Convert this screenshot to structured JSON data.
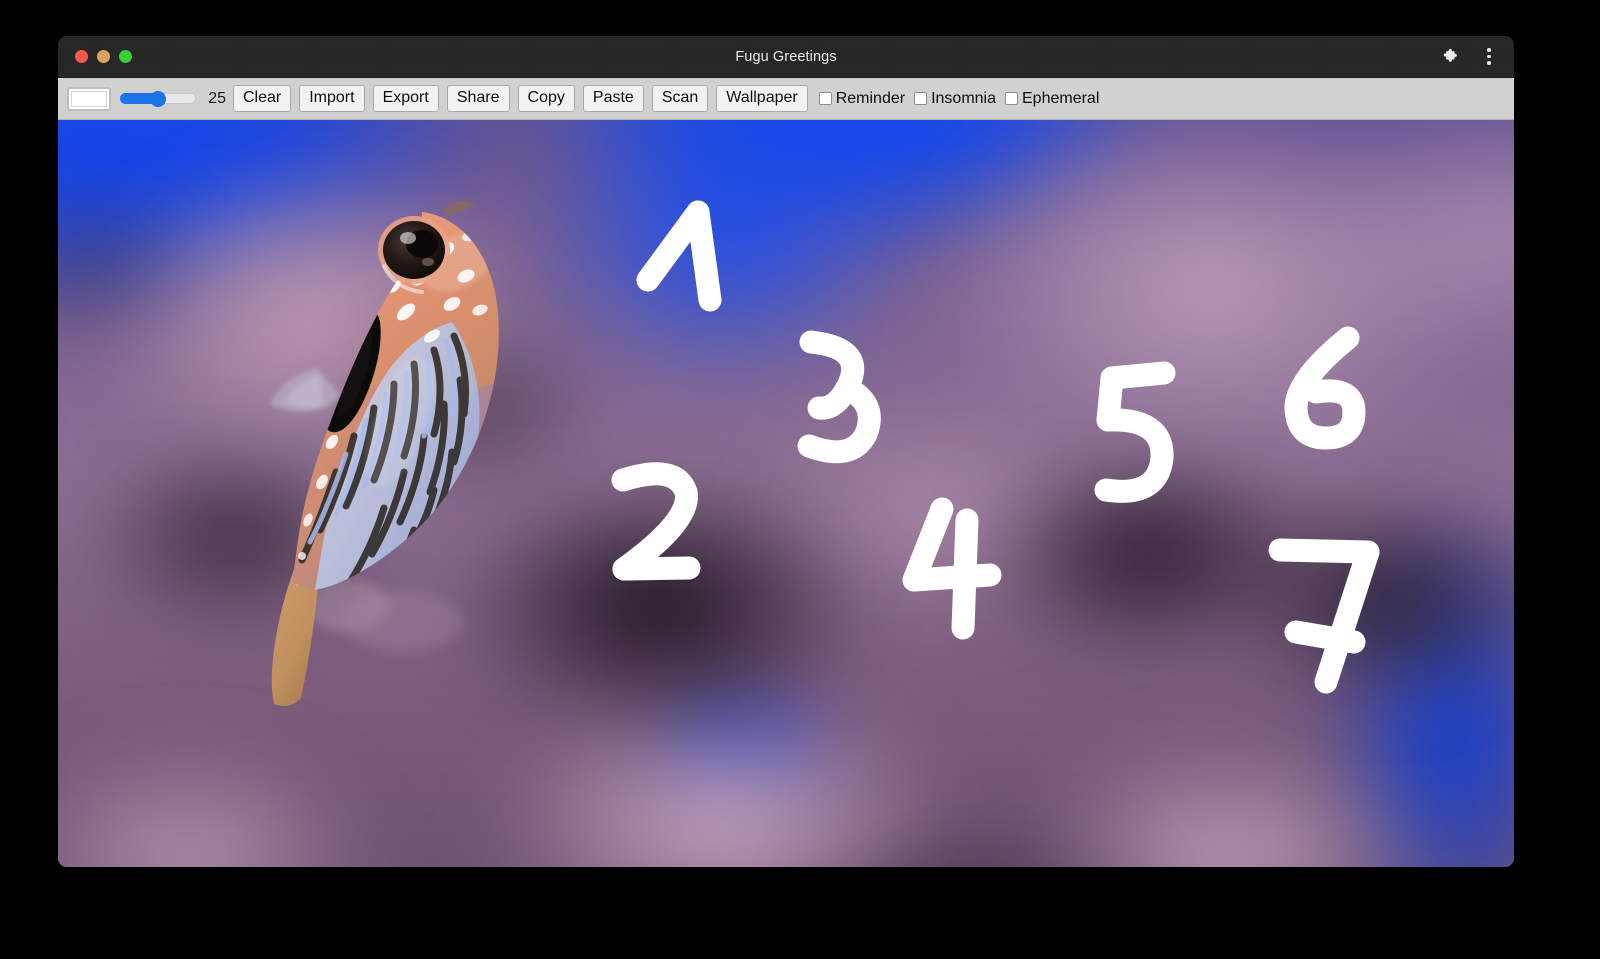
{
  "window": {
    "title": "Fugu Greetings",
    "traffic_lights": [
      {
        "name": "close",
        "color": "#f8574e"
      },
      {
        "name": "minimize",
        "color": "#e0a260"
      },
      {
        "name": "maximize",
        "color": "#35ce33"
      }
    ],
    "right_icons": [
      {
        "name": "extensions-icon",
        "glyph": "puzzle"
      },
      {
        "name": "browser-menu-icon",
        "glyph": "three-dots"
      }
    ]
  },
  "toolbar": {
    "color_picker": {
      "name": "color-picker",
      "value": "#ffffff"
    },
    "slider": {
      "name": "line-width-slider",
      "value": 25,
      "min": 0,
      "max": 50,
      "percent": 50,
      "accent": "#1a73e8"
    },
    "slider_value_label": "25",
    "buttons": [
      {
        "label": "Clear",
        "name": "clear-button"
      },
      {
        "label": "Import",
        "name": "import-button"
      },
      {
        "label": "Export",
        "name": "export-button"
      },
      {
        "label": "Share",
        "name": "share-button"
      },
      {
        "label": "Copy",
        "name": "copy-button"
      },
      {
        "label": "Paste",
        "name": "paste-button"
      },
      {
        "label": "Scan",
        "name": "scan-button"
      },
      {
        "label": "Wallpaper",
        "name": "wallpaper-button"
      }
    ],
    "checkboxes": [
      {
        "label": "Reminder",
        "name": "reminder-checkbox",
        "checked": false
      },
      {
        "label": "Insomnia",
        "name": "insomnia-checkbox",
        "checked": false
      },
      {
        "label": "Ephemeral",
        "name": "ephemeral-checkbox",
        "checked": false
      }
    ]
  },
  "canvas": {
    "name": "drawing-canvas",
    "background_image": "pufferfish-aquarium-photo",
    "stroke_color": "#ffffff",
    "stroke_width": 25,
    "drawn_digits": [
      "1",
      "2",
      "3",
      "4",
      "5",
      "6",
      "7"
    ]
  },
  "colors": {
    "titlebar": "#272727",
    "toolbar": "#d1d1d1",
    "button_face": "#f2f2f2",
    "accent_blue": "#1a73e8",
    "water_blue": "#1344ee",
    "coral_mauve": "#b08aa8",
    "page_background": "#000000"
  }
}
